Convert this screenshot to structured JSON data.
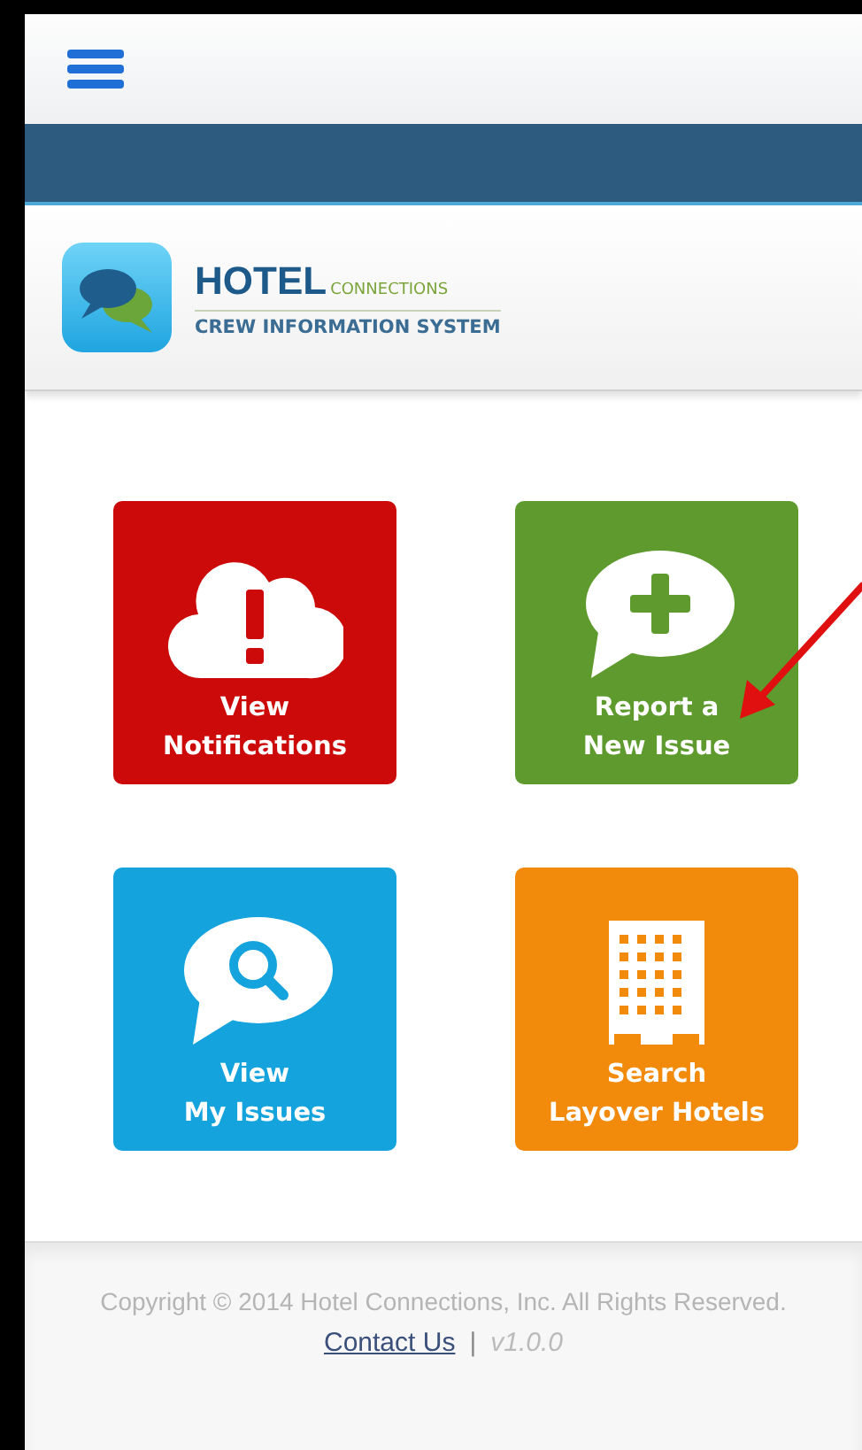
{
  "brand": {
    "name": "HOTEL",
    "name_suffix": "CONNECTIONS",
    "tagline": "CREW INFORMATION SYSTEM"
  },
  "tiles": [
    {
      "kind": "notifications",
      "label": [
        "View",
        "Notifications"
      ],
      "color": "#cc0a0a"
    },
    {
      "kind": "report",
      "label": [
        "Report a",
        "New Issue"
      ],
      "color": "#5e9a2d"
    },
    {
      "kind": "issues",
      "label": [
        "View",
        "My Issues"
      ],
      "color": "#14a3dc"
    },
    {
      "kind": "hotels",
      "label": [
        "Search",
        "Layover Hotels"
      ],
      "color": "#f28a0c"
    }
  ],
  "annotation": {
    "kind": "arrow"
  },
  "footer": {
    "copyright": "Copyright © 2014 Hotel Connections, Inc. All Rights Reserved.",
    "contact_link": "Contact Us",
    "separator": "|",
    "version": "v1.0.0"
  }
}
